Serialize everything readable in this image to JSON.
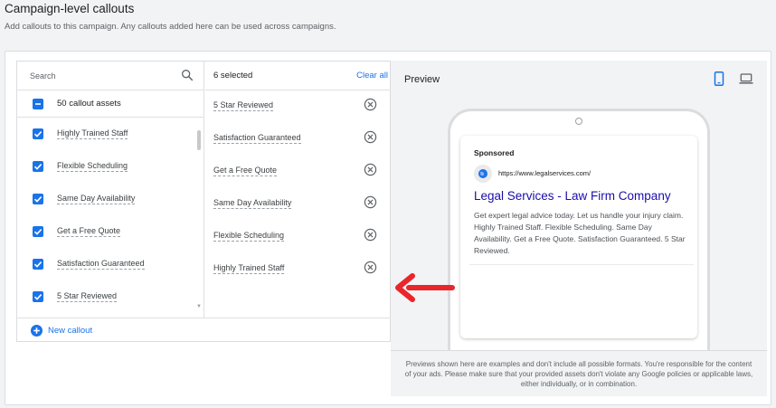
{
  "header": {
    "title": "Campaign-level callouts",
    "subtitle": "Add callouts to this campaign. Any callouts added here can be used across campaigns."
  },
  "search": {
    "placeholder": "Search"
  },
  "assets": {
    "count_label": "50 callout assets",
    "items": [
      {
        "label": "Highly Trained Staff",
        "checked": true
      },
      {
        "label": "Flexible Scheduling",
        "checked": true
      },
      {
        "label": "Same Day Availability",
        "checked": true
      },
      {
        "label": "Get a Free Quote",
        "checked": true
      },
      {
        "label": "Satisfaction Guaranteed",
        "checked": true
      },
      {
        "label": "5 Star Reviewed",
        "checked": true
      }
    ]
  },
  "selected": {
    "count_label": "6 selected",
    "clear_label": "Clear all",
    "items": [
      {
        "label": "5 Star Reviewed"
      },
      {
        "label": "Satisfaction Guaranteed"
      },
      {
        "label": "Get a Free Quote"
      },
      {
        "label": "Same Day Availability"
      },
      {
        "label": "Flexible Scheduling"
      },
      {
        "label": "Highly Trained Staff"
      }
    ]
  },
  "new_callout": {
    "label": "New callout"
  },
  "preview": {
    "title": "Preview",
    "ad": {
      "sponsored": "Sponsored",
      "url": "https://www.legalservices.com/",
      "headline": "Legal Services - Law Firm Company",
      "description": "Get expert legal advice today. Let us handle your injury claim. Highly Trained Staff. Flexible Scheduling. Same Day Availability. Get a Free Quote. Satisfaction Guaranteed. 5 Star Reviewed."
    },
    "disclaimer": "Previews shown here are examples and don't include all possible formats. You're responsible for the content of your ads. Please make sure that your provided assets don't violate any Google policies or applicable laws, either individually, or in combination."
  },
  "colors": {
    "accent": "#1a73e8",
    "headline": "#1a0dab",
    "arrow": "#e8262c"
  },
  "icons": {
    "search": "search-icon",
    "remove": "close-circle-icon",
    "mobile": "mobile-icon",
    "desktop": "laptop-icon",
    "globe": "globe-icon"
  }
}
